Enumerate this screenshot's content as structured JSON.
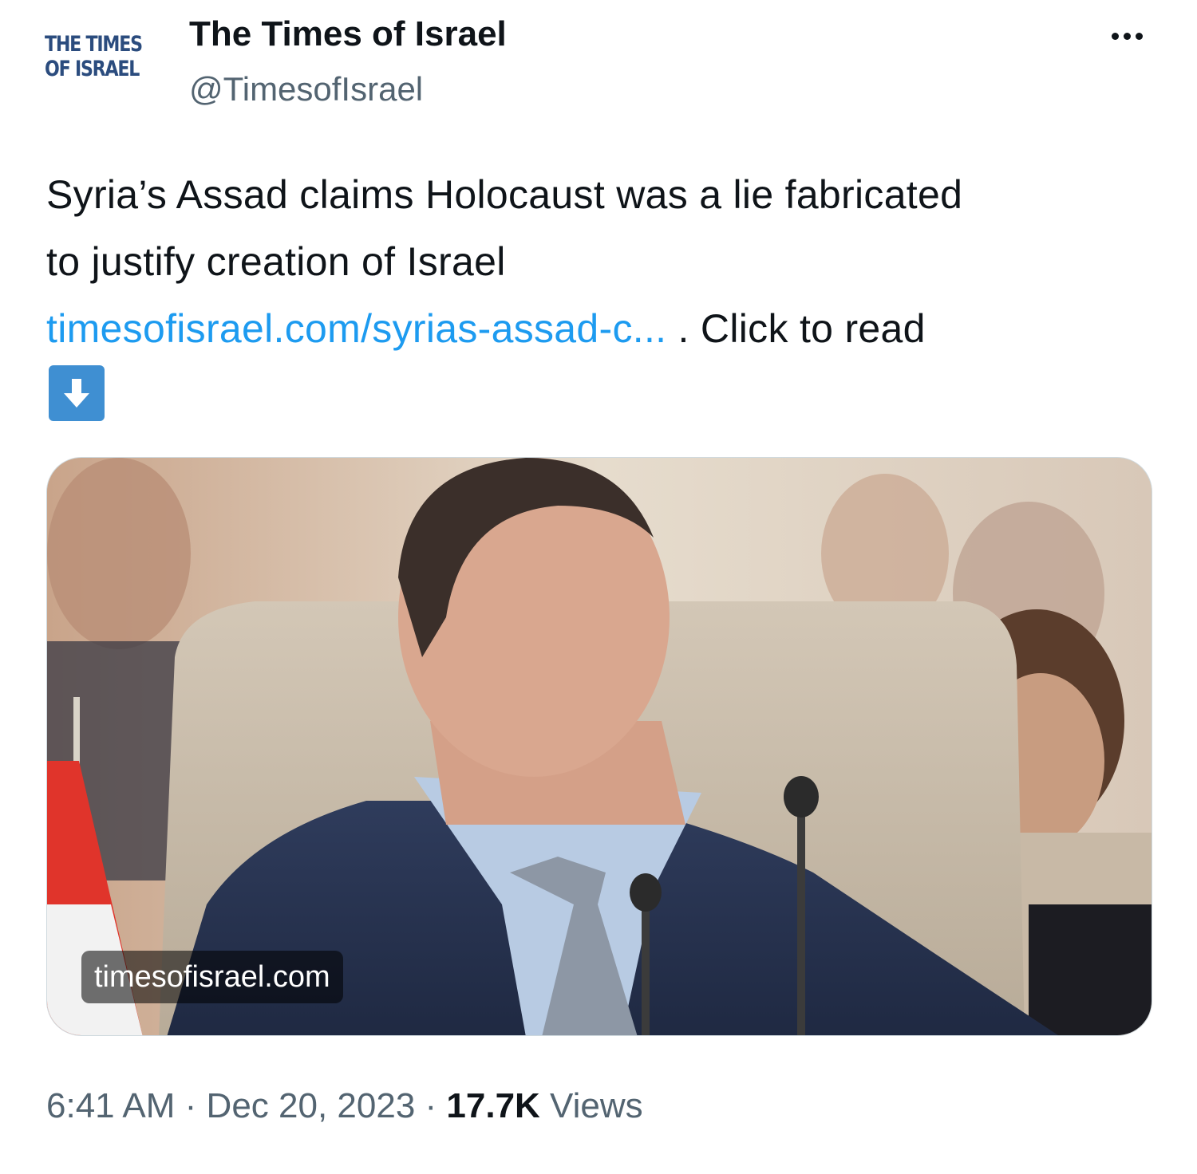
{
  "account": {
    "logo_line1": "THE TIMES",
    "logo_line2": "OF ISRAEL",
    "display_name": "The Times of Israel",
    "handle": "@TimesofIsrael"
  },
  "tweet": {
    "text_line1": "Syria’s Assad claims Holocaust was a lie fabricated",
    "text_line2": "to justify creation of Israel",
    "link_text": "timesofisrael.com/syrias-assad-c...",
    "after_link": " . Click to read",
    "arrow_icon": "down-arrow-emoji-icon"
  },
  "media": {
    "domain_label": "timesofisrael.com"
  },
  "meta": {
    "time": "6:41 AM",
    "separator": " · ",
    "date": "Dec 20, 2023",
    "views_count": "17.7K",
    "views_label": " Views"
  },
  "colors": {
    "link": "#1d9bf0",
    "secondary_text": "#536471",
    "logo": "#2b4c7e",
    "emoji_box": "#3f8fd2"
  }
}
